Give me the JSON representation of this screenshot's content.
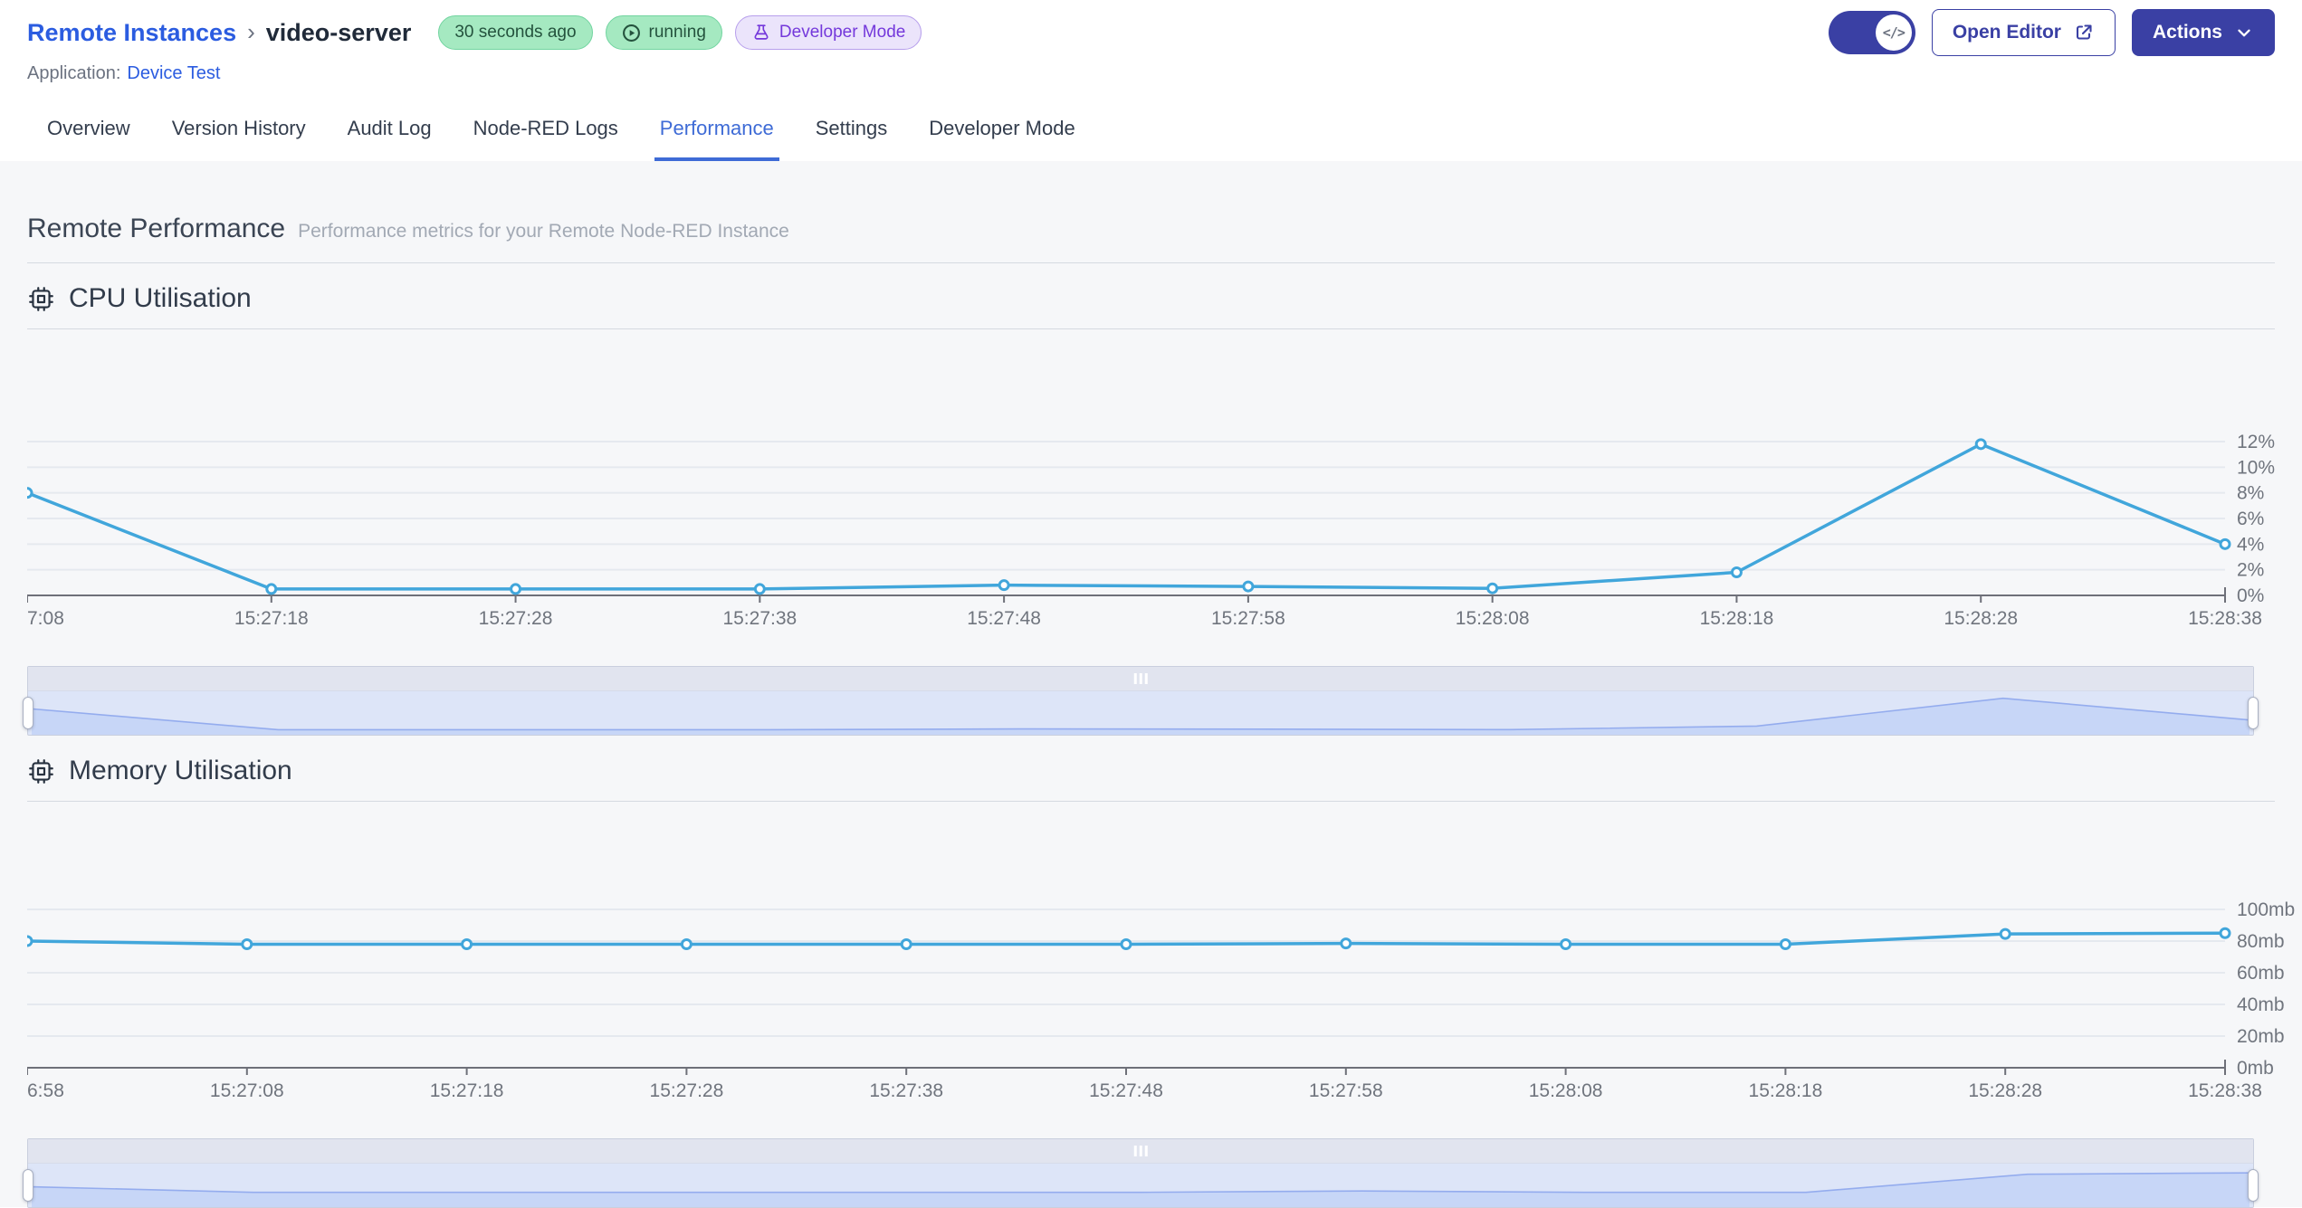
{
  "header": {
    "breadcrumb": {
      "root": "Remote Instances",
      "separator": "›",
      "current": "video-server"
    },
    "badges": {
      "last_updated": "30 seconds ago",
      "status": "running",
      "mode": "Developer Mode"
    },
    "application_label": "Application:",
    "application_name": "Device Test",
    "toggle_glyph": "</>",
    "open_editor_label": "Open Editor",
    "actions_label": "Actions"
  },
  "tabs": [
    {
      "label": "Overview",
      "active": false
    },
    {
      "label": "Version History",
      "active": false
    },
    {
      "label": "Audit Log",
      "active": false
    },
    {
      "label": "Node-RED Logs",
      "active": false
    },
    {
      "label": "Performance",
      "active": true
    },
    {
      "label": "Settings",
      "active": false
    },
    {
      "label": "Developer Mode",
      "active": false
    }
  ],
  "section": {
    "title": "Remote Performance",
    "subtitle": "Performance metrics for your Remote Node-RED Instance"
  },
  "colors": {
    "accent_indigo": "#3A40A4",
    "link_blue": "#2B5CE0",
    "active_tab_blue": "#3E6BD6",
    "chart_line": "#41A6DB",
    "grid_line": "#E5E9EF",
    "axis_line": "#6E7079",
    "axis_text": "#70757E",
    "badge_green_bg": "#A5E9C1",
    "badge_purple_bg": "#EBE4FB",
    "brush_area_fill": "#C7D6F7",
    "brush_area_line": "#94ACEE"
  },
  "chart_data": [
    {
      "id": "cpu",
      "type": "line",
      "title": "CPU Utilisation",
      "icon": "cpu-chip-icon",
      "x_labels": [
        "7:08",
        "15:27:18",
        "15:27:28",
        "15:27:38",
        "15:27:48",
        "15:27:58",
        "15:28:08",
        "15:28:18",
        "15:28:28",
        "15:28:38"
      ],
      "values": [
        8.0,
        0.5,
        0.5,
        0.5,
        0.8,
        0.7,
        0.55,
        1.8,
        11.8,
        4.0
      ],
      "ylabel_unit": "%",
      "ylim": [
        0,
        12
      ],
      "ytick_values": [
        0,
        2,
        4,
        6,
        8,
        10,
        12
      ],
      "ytick_labels": [
        "0%",
        "2%",
        "4%",
        "6%",
        "8%",
        "10%",
        "12%"
      ],
      "grid": true,
      "legend": "none",
      "yaxis_position": "right"
    },
    {
      "id": "memory",
      "type": "line",
      "title": "Memory Utilisation",
      "icon": "cpu-chip-icon",
      "x_labels": [
        "6:58",
        "15:27:08",
        "15:27:18",
        "15:27:28",
        "15:27:38",
        "15:27:48",
        "15:27:58",
        "15:28:08",
        "15:28:18",
        "15:28:28",
        "15:28:38"
      ],
      "values": [
        80,
        78,
        78,
        78,
        78,
        78,
        78.5,
        78,
        78,
        84.5,
        85
      ],
      "ylabel_unit": "mb",
      "ylim": [
        0,
        100
      ],
      "ytick_values": [
        0,
        20,
        40,
        60,
        80,
        100
      ],
      "ytick_labels": [
        "0mb",
        "20mb",
        "40mb",
        "60mb",
        "80mb",
        "100mb"
      ],
      "grid": true,
      "legend": "none",
      "yaxis_position": "right"
    }
  ]
}
